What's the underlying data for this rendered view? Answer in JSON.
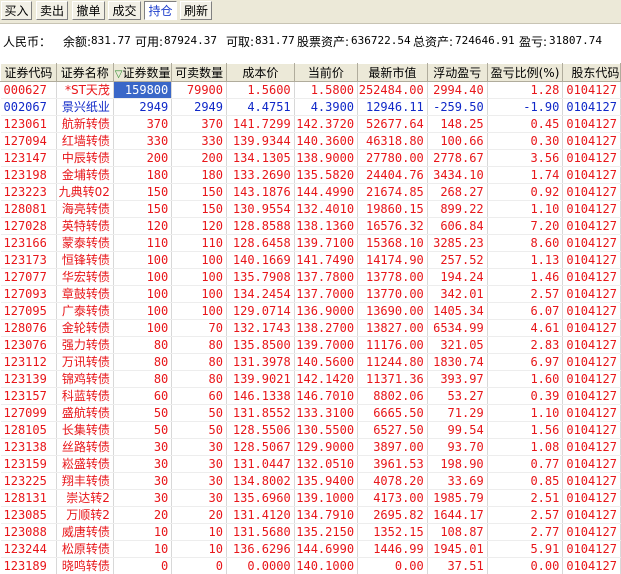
{
  "toolbar": {
    "buttons": [
      {
        "label": "买入"
      },
      {
        "label": "卖出"
      },
      {
        "label": "撤单"
      },
      {
        "label": "成交"
      },
      {
        "label": "持仓"
      },
      {
        "label": "刷新"
      }
    ],
    "active_index": 4
  },
  "summary": {
    "currency": "人民币：",
    "balance_label": "余额:",
    "balance": "831.77",
    "available_label": "可用:",
    "available": "87924.37",
    "withdrawable_label": "可取:",
    "withdrawable": "831.77",
    "stock_assets_label": "股票资产:",
    "stock_assets": "636722.54",
    "total_assets_label": "总资产:",
    "total_assets": "724646.91",
    "pnl_label": "盈亏:",
    "pnl": "31807.74"
  },
  "table": {
    "columns": [
      "证券代码",
      "证券名称",
      "证券数量",
      "可卖数量",
      "成本价",
      "当前价",
      "最新市值",
      "浮动盈亏",
      "盈亏比例(%)",
      "股东代码"
    ],
    "sort_marker": "▽",
    "rows": [
      {
        "code": "000627",
        "name": "*ST天茂",
        "qty": "159800",
        "sellable": "79900",
        "cost": "1.5600",
        "price": "1.5800",
        "value": "252484.00",
        "pnl": "2994.40",
        "ratio": "1.28",
        "holder": "0104127",
        "color": "red"
      },
      {
        "code": "002067",
        "name": "景兴纸业",
        "qty": "2949",
        "sellable": "2949",
        "cost": "4.4751",
        "price": "4.3900",
        "value": "12946.11",
        "pnl": "-259.50",
        "ratio": "-1.90",
        "holder": "0104127",
        "color": "blue"
      },
      {
        "code": "123061",
        "name": "航新转债",
        "qty": "370",
        "sellable": "370",
        "cost": "141.7299",
        "price": "142.3720",
        "value": "52677.64",
        "pnl": "148.25",
        "ratio": "0.45",
        "holder": "0104127",
        "color": "red"
      },
      {
        "code": "127094",
        "name": "红墙转债",
        "qty": "330",
        "sellable": "330",
        "cost": "139.9344",
        "price": "140.3600",
        "value": "46318.80",
        "pnl": "100.66",
        "ratio": "0.30",
        "holder": "0104127",
        "color": "red"
      },
      {
        "code": "123147",
        "name": "中辰转债",
        "qty": "200",
        "sellable": "200",
        "cost": "134.1305",
        "price": "138.9000",
        "value": "27780.00",
        "pnl": "2778.67",
        "ratio": "3.56",
        "holder": "0104127",
        "color": "red"
      },
      {
        "code": "123198",
        "name": "金埔转债",
        "qty": "180",
        "sellable": "180",
        "cost": "133.2690",
        "price": "135.5820",
        "value": "24404.76",
        "pnl": "3434.10",
        "ratio": "1.74",
        "holder": "0104127",
        "color": "red"
      },
      {
        "code": "123223",
        "name": "九典转02",
        "qty": "150",
        "sellable": "150",
        "cost": "143.1876",
        "price": "144.4990",
        "value": "21674.85",
        "pnl": "268.27",
        "ratio": "0.92",
        "holder": "0104127",
        "color": "red"
      },
      {
        "code": "128081",
        "name": "海亮转债",
        "qty": "150",
        "sellable": "150",
        "cost": "130.9554",
        "price": "132.4010",
        "value": "19860.15",
        "pnl": "899.22",
        "ratio": "1.10",
        "holder": "0104127",
        "color": "red"
      },
      {
        "code": "127028",
        "name": "英特转债",
        "qty": "120",
        "sellable": "120",
        "cost": "128.8588",
        "price": "138.1360",
        "value": "16576.32",
        "pnl": "606.84",
        "ratio": "7.20",
        "holder": "0104127",
        "color": "red"
      },
      {
        "code": "123166",
        "name": "蒙泰转债",
        "qty": "110",
        "sellable": "110",
        "cost": "128.6458",
        "price": "139.7100",
        "value": "15368.10",
        "pnl": "3285.23",
        "ratio": "8.60",
        "holder": "0104127",
        "color": "red"
      },
      {
        "code": "123173",
        "name": "恒锋转债",
        "qty": "100",
        "sellable": "100",
        "cost": "140.1669",
        "price": "141.7490",
        "value": "14174.90",
        "pnl": "257.52",
        "ratio": "1.13",
        "holder": "0104127",
        "color": "red"
      },
      {
        "code": "127077",
        "name": "华宏转债",
        "qty": "100",
        "sellable": "100",
        "cost": "135.7908",
        "price": "137.7800",
        "value": "13778.00",
        "pnl": "194.24",
        "ratio": "1.46",
        "holder": "0104127",
        "color": "red"
      },
      {
        "code": "127093",
        "name": "章鼓转债",
        "qty": "100",
        "sellable": "100",
        "cost": "134.2454",
        "price": "137.7000",
        "value": "13770.00",
        "pnl": "342.01",
        "ratio": "2.57",
        "holder": "0104127",
        "color": "red"
      },
      {
        "code": "127095",
        "name": "广泰转债",
        "qty": "100",
        "sellable": "100",
        "cost": "129.0714",
        "price": "136.9000",
        "value": "13690.00",
        "pnl": "1405.34",
        "ratio": "6.07",
        "holder": "0104127",
        "color": "red"
      },
      {
        "code": "128076",
        "name": "金轮转债",
        "qty": "100",
        "sellable": "70",
        "cost": "132.1743",
        "price": "138.2700",
        "value": "13827.00",
        "pnl": "6534.99",
        "ratio": "4.61",
        "holder": "0104127",
        "color": "red"
      },
      {
        "code": "123076",
        "name": "强力转债",
        "qty": "80",
        "sellable": "80",
        "cost": "135.8500",
        "price": "139.7000",
        "value": "11176.00",
        "pnl": "321.05",
        "ratio": "2.83",
        "holder": "0104127",
        "color": "red"
      },
      {
        "code": "123112",
        "name": "万讯转债",
        "qty": "80",
        "sellable": "80",
        "cost": "131.3978",
        "price": "140.5600",
        "value": "11244.80",
        "pnl": "1830.74",
        "ratio": "6.97",
        "holder": "0104127",
        "color": "red"
      },
      {
        "code": "123139",
        "name": "锦鸡转债",
        "qty": "80",
        "sellable": "80",
        "cost": "139.9021",
        "price": "142.1420",
        "value": "11371.36",
        "pnl": "393.97",
        "ratio": "1.60",
        "holder": "0104127",
        "color": "red"
      },
      {
        "code": "123157",
        "name": "科蓝转债",
        "qty": "60",
        "sellable": "60",
        "cost": "146.1338",
        "price": "146.7010",
        "value": "8802.06",
        "pnl": "53.27",
        "ratio": "0.39",
        "holder": "0104127",
        "color": "red"
      },
      {
        "code": "127099",
        "name": "盛航转债",
        "qty": "50",
        "sellable": "50",
        "cost": "131.8552",
        "price": "133.3100",
        "value": "6665.50",
        "pnl": "71.29",
        "ratio": "1.10",
        "holder": "0104127",
        "color": "red"
      },
      {
        "code": "128105",
        "name": "长集转债",
        "qty": "50",
        "sellable": "50",
        "cost": "128.5506",
        "price": "130.5500",
        "value": "6527.50",
        "pnl": "99.54",
        "ratio": "1.56",
        "holder": "0104127",
        "color": "red"
      },
      {
        "code": "123138",
        "name": "丝路转债",
        "qty": "30",
        "sellable": "30",
        "cost": "128.5067",
        "price": "129.9000",
        "value": "3897.00",
        "pnl": "93.70",
        "ratio": "1.08",
        "holder": "0104127",
        "color": "red"
      },
      {
        "code": "123159",
        "name": "崧盛转债",
        "qty": "30",
        "sellable": "30",
        "cost": "131.0447",
        "price": "132.0510",
        "value": "3961.53",
        "pnl": "198.90",
        "ratio": "0.77",
        "holder": "0104127",
        "color": "red"
      },
      {
        "code": "123225",
        "name": "翔丰转债",
        "qty": "30",
        "sellable": "30",
        "cost": "134.8002",
        "price": "135.9400",
        "value": "4078.20",
        "pnl": "33.69",
        "ratio": "0.85",
        "holder": "0104127",
        "color": "red"
      },
      {
        "code": "128131",
        "name": "崇达转2",
        "qty": "30",
        "sellable": "30",
        "cost": "135.6960",
        "price": "139.1000",
        "value": "4173.00",
        "pnl": "1985.79",
        "ratio": "2.51",
        "holder": "0104127",
        "color": "red"
      },
      {
        "code": "123085",
        "name": "万顺转2",
        "qty": "20",
        "sellable": "20",
        "cost": "131.4120",
        "price": "134.7910",
        "value": "2695.82",
        "pnl": "1644.17",
        "ratio": "2.57",
        "holder": "0104127",
        "color": "red"
      },
      {
        "code": "123088",
        "name": "威唐转债",
        "qty": "10",
        "sellable": "10",
        "cost": "131.5680",
        "price": "135.2150",
        "value": "1352.15",
        "pnl": "108.87",
        "ratio": "2.77",
        "holder": "0104127",
        "color": "red"
      },
      {
        "code": "123244",
        "name": "松原转债",
        "qty": "10",
        "sellable": "10",
        "cost": "136.6296",
        "price": "144.6990",
        "value": "1446.99",
        "pnl": "1945.01",
        "ratio": "5.91",
        "holder": "0104127",
        "color": "red"
      },
      {
        "code": "123189",
        "name": "晓鸣转债",
        "qty": "0",
        "sellable": "0",
        "cost": "0.0000",
        "price": "140.1000",
        "value": "0.00",
        "pnl": "37.51",
        "ratio": "0.00",
        "holder": "0104127",
        "color": "red"
      }
    ]
  }
}
